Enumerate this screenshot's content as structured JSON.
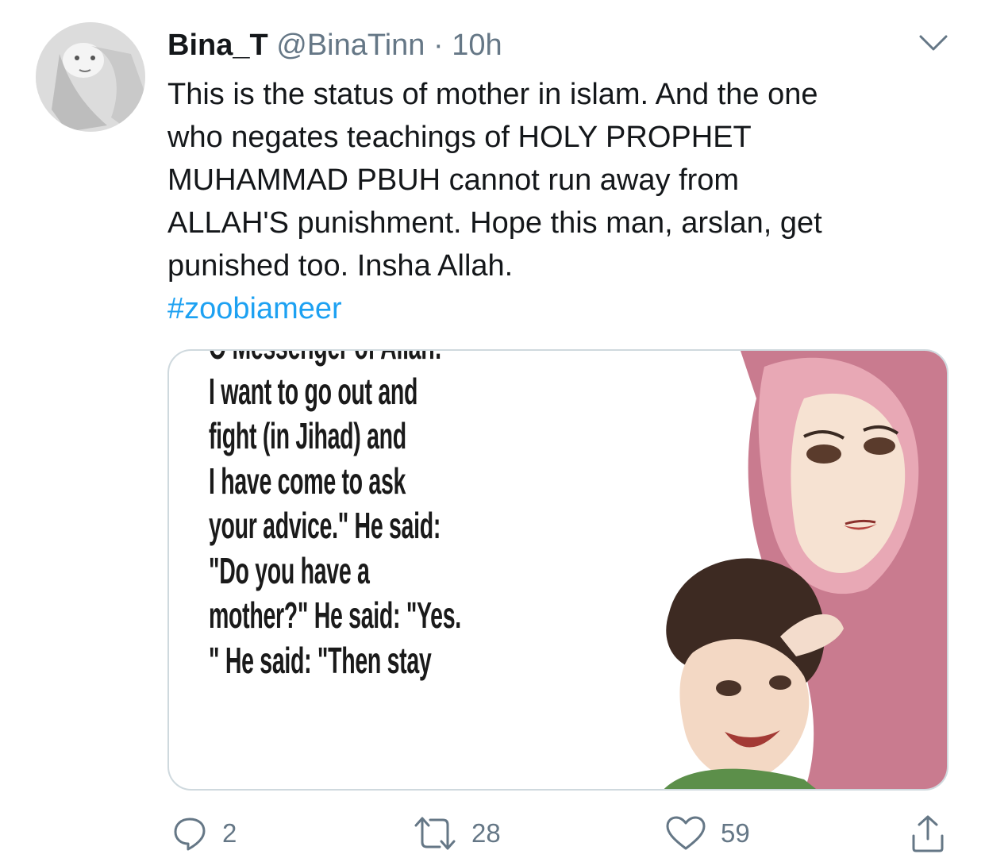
{
  "tweet": {
    "display_name": "Bina_T",
    "handle": "@BinaTinn",
    "separator": "·",
    "time": "10h",
    "text_lines": [
      "This is the status of mother in islam. And the one",
      "who negates teachings of HOLY PROPHET",
      "MUHAMMAD PBUH cannot run away from",
      "ALLAH'S punishment. Hope this man, arslan, get",
      "punished too. Insha Allah."
    ],
    "hashtag": "#zoobiameer"
  },
  "media": {
    "quote_lines": [
      "O Messenger of Allah:",
      "I want to go out and",
      "fight (in Jihad) and",
      "I have come to ask",
      "your advice.\" He said:",
      "\"Do you have a",
      "mother?\" He said: \"Yes.",
      "\" He said: \"Then stay"
    ]
  },
  "actions": {
    "reply_count": "2",
    "retweet_count": "28",
    "like_count": "59"
  },
  "icons": {
    "avatar": "avatar-image",
    "menu": "chevron-down-icon",
    "reply": "reply-icon",
    "retweet": "retweet-icon",
    "like": "heart-icon",
    "share": "share-icon"
  },
  "colors": {
    "link": "#1da1f2",
    "muted": "#657786",
    "text": "#14171a",
    "border": "#cfd9de"
  }
}
